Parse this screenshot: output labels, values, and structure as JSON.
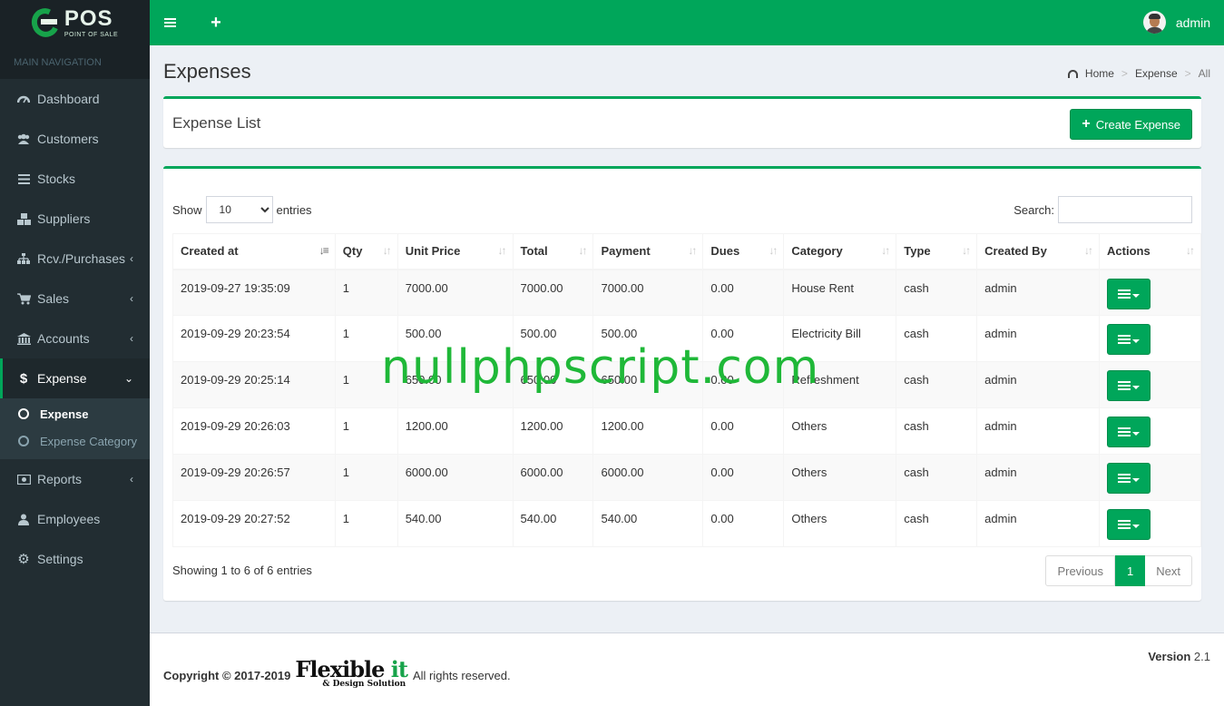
{
  "brand": {
    "logo_text": "POS",
    "logo_sub": "POINT OF SALE"
  },
  "sidebar": {
    "header": "MAIN NAVIGATION",
    "items": [
      {
        "label": "Dashboard",
        "icon": "dashboard-icon"
      },
      {
        "label": "Customers",
        "icon": "users-icon"
      },
      {
        "label": "Stocks",
        "icon": "list-icon"
      },
      {
        "label": "Suppliers",
        "icon": "cubes-icon"
      },
      {
        "label": "Rcv./Purchases",
        "icon": "sitemap-icon"
      },
      {
        "label": "Sales",
        "icon": "cart-icon"
      },
      {
        "label": "Accounts",
        "icon": "bank-icon"
      },
      {
        "label": "Expense",
        "icon": "dollar-icon"
      },
      {
        "label": "Reports",
        "icon": "money-icon"
      },
      {
        "label": "Employees",
        "icon": "user-icon"
      },
      {
        "label": "Settings",
        "icon": "gear-icon"
      }
    ],
    "expense_sub": [
      {
        "label": "Expense"
      },
      {
        "label": "Expense Category"
      }
    ]
  },
  "topbar": {
    "user": "admin"
  },
  "header": {
    "title": "Expenses",
    "breadcrumb": [
      "Home",
      "Expense",
      "All"
    ]
  },
  "list_box": {
    "title": "Expense List",
    "create_label": "Create Expense"
  },
  "datatable": {
    "show_label": "Show",
    "entries_label": "entries",
    "length_value": "10",
    "search_label": "Search:",
    "columns": [
      "Created at",
      "Qty",
      "Unit Price",
      "Total",
      "Payment",
      "Dues",
      "Category",
      "Type",
      "Created By",
      "Actions"
    ],
    "rows": [
      [
        "2019-09-27 19:35:09",
        "1",
        "7000.00",
        "7000.00",
        "7000.00",
        "0.00",
        "House Rent",
        "cash",
        "admin"
      ],
      [
        "2019-09-29 20:23:54",
        "1",
        "500.00",
        "500.00",
        "500.00",
        "0.00",
        "Electricity Bill",
        "cash",
        "admin"
      ],
      [
        "2019-09-29 20:25:14",
        "1",
        "650.00",
        "650.00",
        "650.00",
        "0.00",
        "Refreshment",
        "cash",
        "admin"
      ],
      [
        "2019-09-29 20:26:03",
        "1",
        "1200.00",
        "1200.00",
        "1200.00",
        "0.00",
        "Others",
        "cash",
        "admin"
      ],
      [
        "2019-09-29 20:26:57",
        "1",
        "6000.00",
        "6000.00",
        "6000.00",
        "0.00",
        "Others",
        "cash",
        "admin"
      ],
      [
        "2019-09-29 20:27:52",
        "1",
        "540.00",
        "540.00",
        "540.00",
        "0.00",
        "Others",
        "cash",
        "admin"
      ]
    ],
    "info": "Showing 1 to 6 of 6 entries",
    "pager": {
      "prev": "Previous",
      "current": "1",
      "next": "Next"
    }
  },
  "watermark": "nullphpscript.com",
  "footer": {
    "copyright": "Copyright © 2017-2019",
    "company_a": "Flexible",
    "company_b": "it",
    "company_sub": "& Design Solution",
    "rights": "All rights reserved.",
    "version_label": "Version",
    "version_value": "2.1"
  },
  "colors": {
    "accent": "#00a65a",
    "sidebar": "#222d32",
    "sidebar_dark": "#1a2226"
  }
}
